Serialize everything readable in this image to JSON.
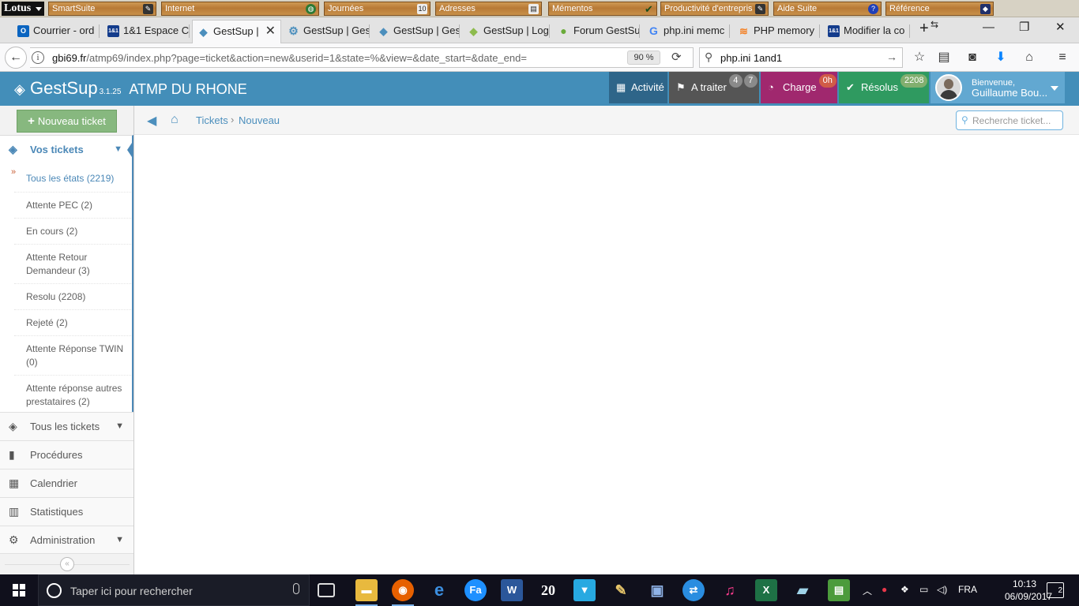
{
  "lotus": {
    "logo": "Lotus",
    "drawers": [
      "SmartSuite",
      "Internet",
      "Journées",
      "Adresses",
      "Mémentos",
      "Productivité d'entrepris",
      "Aide Suite",
      "Référence"
    ]
  },
  "browser": {
    "tabs": [
      {
        "label": "Courrier - ord",
        "icon_text": "O"
      },
      {
        "label": "1&1 Espace C",
        "icon_text": "1&1"
      },
      {
        "label": "GestSup |",
        "icon_text": "◆"
      },
      {
        "label": "GestSup | Ges",
        "icon_text": "⚙"
      },
      {
        "label": "GestSup | Gest",
        "icon_text": "◆"
      },
      {
        "label": "GestSup | Log",
        "icon_text": "◆"
      },
      {
        "label": "Forum GestSu",
        "icon_text": "●"
      },
      {
        "label": "php.ini memc",
        "icon_text": "G"
      },
      {
        "label": "PHP memory",
        "icon_text": "≋"
      },
      {
        "label": "Modifier la co",
        "icon_text": "1&1"
      }
    ],
    "url_domain": "gbi69.fr",
    "url_path": "/atmp69/index.php?page=ticket&action=new&userid=1&state=%&view=&date_start=&date_end=",
    "zoom": "90 %",
    "search_value": "php.ini 1and1"
  },
  "app": {
    "brand": "GestSup",
    "version": "3.1.25",
    "org": "ATMP DU RHONE",
    "header": {
      "activity": "Activité",
      "todo": "A traiter",
      "todo_badge1": "4",
      "todo_badge2": "7",
      "charge": "Charge",
      "charge_badge": "0h",
      "resolved": "Résolus",
      "resolved_badge": "2208",
      "welcome": "Bienvenue,",
      "user": "Guillaume Bou..."
    },
    "sidebar": {
      "new_ticket": "Nouveau ticket",
      "my_tickets": "Vos tickets",
      "sub_items": [
        "Tous les états (2219)",
        "Attente PEC (2)",
        "En cours (2)",
        "Attente Retour Demandeur (3)",
        "Resolu (2208)",
        "Rejeté (2)",
        "Attente Réponse TWIN (0)",
        "Attente réponse autres prestataires (2)"
      ],
      "all_tickets": "Tous les tickets",
      "procedures": "Procédures",
      "calendar": "Calendrier",
      "stats": "Statistiques",
      "admin": "Administration"
    },
    "breadcrumb": {
      "tickets": "Tickets",
      "new": "Nouveau",
      "search_placeholder": "Recherche ticket..."
    }
  },
  "taskbar": {
    "search_placeholder": "Taper ici pour rechercher",
    "lang": "FRA",
    "time": "10:13",
    "date": "06/09/2017",
    "notifications": "2"
  },
  "colors": {
    "header_blue": "#438eb9",
    "activity": "#2e6589",
    "todo": "#555555",
    "charge": "#a0286e",
    "resolved": "#2f9a60",
    "user": "#62a8d1",
    "new_ticket": "#87b87f"
  }
}
